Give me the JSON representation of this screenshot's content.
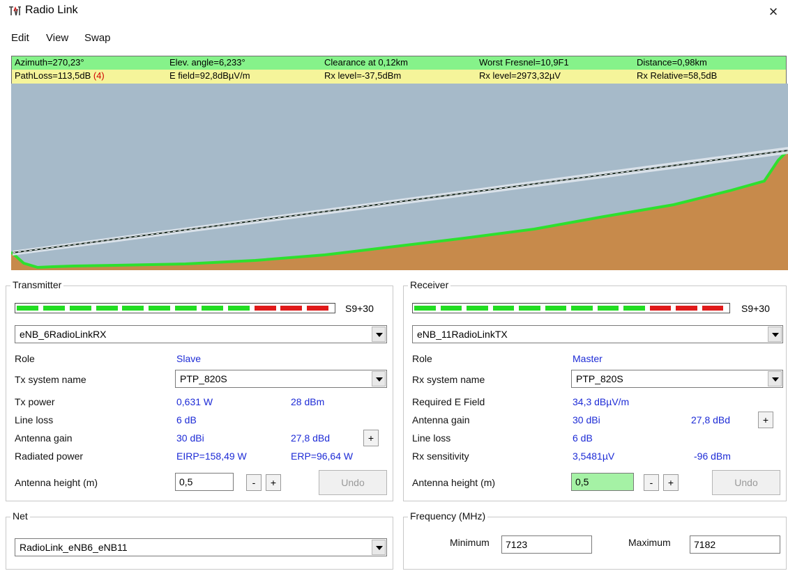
{
  "window": {
    "title": "Radio Link",
    "icon": "radio-link-icon",
    "close_glyph": "×"
  },
  "menu": [
    "Edit",
    "View",
    "Swap"
  ],
  "info": {
    "row1": [
      "Azimuth=270,23°",
      "Elev. angle=6,233°",
      "Clearance at 0,12km",
      "Worst Fresnel=10,9F1",
      "Distance=0,98km"
    ],
    "row2": [
      "PathLoss=113,5dB ",
      "E field=92,8dBµV/m",
      "Rx level=-37,5dBm",
      "Rx level=2973,32µV",
      "Rx Relative=58,5dB"
    ],
    "pathloss_tag": "(4)",
    "colors": {
      "row1_bg": "#86f28a",
      "row2_bg": "#f5f49a"
    }
  },
  "profile": {
    "colors": {
      "sky": "#a6bac9",
      "terrain": "#c78a4b",
      "terrain_line": "#2ee02e",
      "link_line": "#1a2a20"
    }
  },
  "transmitter": {
    "title": "Transmitter",
    "meter": {
      "label": "S9+30",
      "green_segments": 9,
      "red_segments": 3,
      "green": "#22dd22",
      "red": "#e01a1a"
    },
    "site": "eNB_6RadioLinkRX",
    "role_label": "Role",
    "role_value": "Slave",
    "system_label": "Tx system name",
    "system_value": "PTP_820S",
    "tx_power_label": "Tx power",
    "tx_power_w": "0,631 W",
    "tx_power_dbm": "28 dBm",
    "line_loss_label": "Line loss",
    "line_loss_value": "6 dB",
    "antenna_gain_label": "Antenna gain",
    "antenna_gain_dbi": "30 dBi",
    "antenna_gain_dbd": "27,8 dBd",
    "radiated_label": "Radiated power",
    "eirp": "EIRP=158,49 W",
    "erp": "ERP=96,64 W",
    "height_label": "Antenna height (m)",
    "height_value": "0,5",
    "minus": "-",
    "plus": "+",
    "undo": "Undo"
  },
  "receiver": {
    "title": "Receiver",
    "meter": {
      "label": "S9+30",
      "green_segments": 9,
      "red_segments": 3
    },
    "site": "eNB_11RadioLinkTX",
    "role_label": "Role",
    "role_value": "Master",
    "system_label": "Rx system name",
    "system_value": "PTP_820S",
    "req_field_label": "Required E Field",
    "req_field_value": "34,3 dBµV/m",
    "antenna_gain_label": "Antenna gain",
    "antenna_gain_dbi": "30 dBi",
    "antenna_gain_dbd": "27,8 dBd",
    "line_loss_label": "Line loss",
    "line_loss_value": "6 dB",
    "sensitivity_label": "Rx sensitivity",
    "sensitivity_uv": "3,5481µV",
    "sensitivity_dbm": "-96 dBm",
    "height_label": "Antenna height (m)",
    "height_value": "0,5",
    "height_bg": "#a5f2a5",
    "minus": "-",
    "plus": "+",
    "undo": "Undo"
  },
  "net": {
    "title": "Net",
    "value": "RadioLink_eNB6_eNB11"
  },
  "frequency": {
    "title": "Frequency (MHz)",
    "min_label": "Minimum",
    "min_value": "7123",
    "max_label": "Maximum",
    "max_value": "7182"
  }
}
